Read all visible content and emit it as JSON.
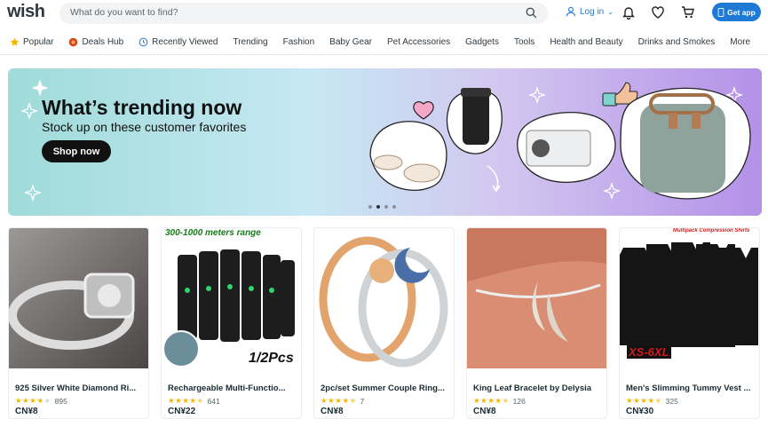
{
  "header": {
    "logo": "wish",
    "search_placeholder": "What do you want to find?",
    "login_label": "Log in",
    "get_app_label": "Get app"
  },
  "nav": {
    "items": [
      {
        "label": "Popular",
        "icon": "star-icon"
      },
      {
        "label": "Deals Hub",
        "icon": "deals-icon"
      },
      {
        "label": "Recently Viewed",
        "icon": "clock-icon"
      },
      {
        "label": "Trending"
      },
      {
        "label": "Fashion"
      },
      {
        "label": "Baby Gear"
      },
      {
        "label": "Pet Accessories"
      },
      {
        "label": "Gadgets"
      },
      {
        "label": "Tools"
      },
      {
        "label": "Health and Beauty"
      },
      {
        "label": "Drinks and Smokes"
      },
      {
        "label": "More"
      }
    ]
  },
  "banner": {
    "title": "What’s trending now",
    "subtitle": "Stock up on these customer favorites",
    "button_label": "Shop now",
    "active_slide": 2,
    "slide_count": 4
  },
  "products": [
    {
      "title": "925 Silver White Diamond Ri...",
      "stars": 4,
      "reviews": "895",
      "price": "CN¥8",
      "overlay": ""
    },
    {
      "title": "Rechargeable Multi-Functio...",
      "stars": 4.5,
      "reviews": "641",
      "price": "CN¥22",
      "overlay_top": "300-1000 meters range",
      "overlay_bottom": "1/2Pcs"
    },
    {
      "title": "2pc/set Summer Couple Ring...",
      "stars": 4.5,
      "reviews": "7",
      "price": "CN¥8"
    },
    {
      "title": "King Leaf Bracelet by Delysia",
      "stars": 4.5,
      "reviews": "126",
      "price": "CN¥8"
    },
    {
      "title": "Men's Slimming Tummy Vest ...",
      "stars": 4.5,
      "reviews": "325",
      "price": "CN¥30",
      "overlay_top": "Multipack Compression Shirts",
      "overlay_bottom": "XS-6XL"
    }
  ],
  "colors": {
    "accent": "#1f7ad6",
    "star": "#f4b400"
  }
}
